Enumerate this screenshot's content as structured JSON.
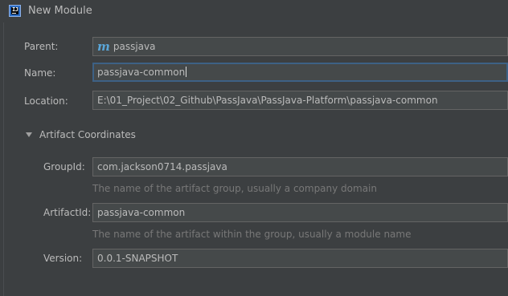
{
  "window": {
    "title": "New Module",
    "app_icon": "intellij-idea-icon",
    "app_icon_text": "IJ"
  },
  "form": {
    "parent": {
      "label": "Parent:",
      "value": "passjava",
      "icon": "maven-module-icon",
      "icon_glyph": "m"
    },
    "name": {
      "label": "Name:",
      "value": "passjava-common"
    },
    "location": {
      "label": "Location:",
      "value": "E:\\01_Project\\02_Github\\PassJava\\PassJava-Platform\\passjava-common"
    }
  },
  "artifact": {
    "section_title": "Artifact Coordinates",
    "group_id": {
      "label": "GroupId:",
      "value": "com.jackson0714.passjava",
      "hint": "The name of the artifact group, usually a company domain"
    },
    "artifact_id": {
      "label": "ArtifactId:",
      "value": "passjava-common",
      "hint": "The name of the artifact within the group, usually a module name"
    },
    "version": {
      "label": "Version:",
      "value": "0.0.1-SNAPSHOT"
    }
  },
  "colors": {
    "background": "#3c3f41",
    "field_background": "#45494a",
    "focus_border": "#3d6185",
    "hint_text": "#787878"
  }
}
